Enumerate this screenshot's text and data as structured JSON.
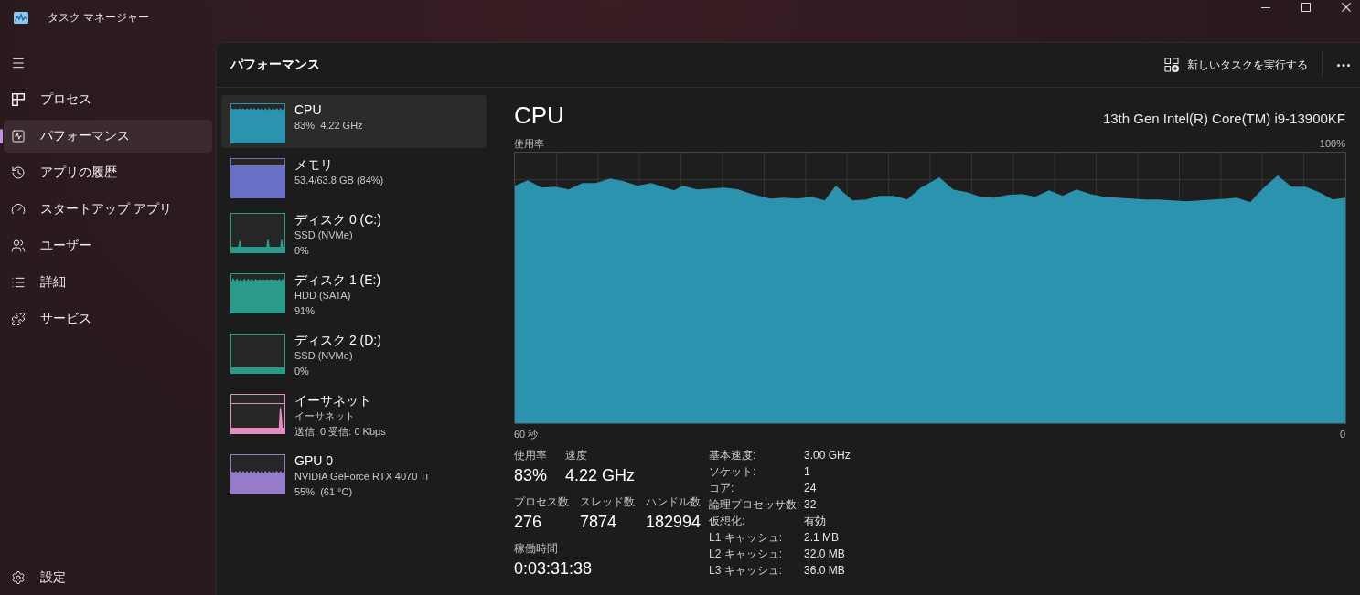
{
  "window": {
    "title": "タスク マネージャー"
  },
  "sidebar": {
    "items": [
      {
        "label": "プロセス",
        "selected": false
      },
      {
        "label": "パフォーマンス",
        "selected": true
      },
      {
        "label": "アプリの履歴",
        "selected": false
      },
      {
        "label": "スタートアップ アプリ",
        "selected": false
      },
      {
        "label": "ユーザー",
        "selected": false
      },
      {
        "label": "詳細",
        "selected": false
      },
      {
        "label": "サービス",
        "selected": false
      }
    ],
    "settings": {
      "label": "設定",
      "selected": false
    }
  },
  "header": {
    "title": "パフォーマンス",
    "run_task_button": "新しいタスクを実行する"
  },
  "devices": [
    {
      "name": "CPU",
      "details": [
        "83%  4.22 GHz"
      ],
      "color": "#2b93ad",
      "selected": true
    },
    {
      "name": "メモリ",
      "details": [
        "53.4/63.8 GB (84%)"
      ],
      "color": "#6870c6",
      "selected": false
    },
    {
      "name": "ディスク 0 (C:)",
      "details": [
        "SSD (NVMe)",
        "0%"
      ],
      "color": "#2a9b8a",
      "selected": false
    },
    {
      "name": "ディスク 1 (E:)",
      "details": [
        "HDD (SATA)",
        "91%"
      ],
      "color": "#2a9b8a",
      "selected": false
    },
    {
      "name": "ディスク 2 (D:)",
      "details": [
        "SSD (NVMe)",
        "0%"
      ],
      "color": "#2a9b8a",
      "selected": false
    },
    {
      "name": "イーサネット",
      "details": [
        "イーサネット",
        "送信: 0 受信: 0 Kbps"
      ],
      "color": "#e38cc1",
      "selected": false
    },
    {
      "name": "GPU 0",
      "details": [
        "NVIDIA GeForce RTX 4070 Ti",
        "55%  (61 °C)"
      ],
      "color": "#967bc8",
      "selected": false
    }
  ],
  "detail": {
    "title": "CPU",
    "model": "13th Gen Intel(R) Core(TM) i9-13900KF",
    "chart": {
      "label": "使用率",
      "max_label": "100%",
      "start_label": "60 秒",
      "end_label": "0"
    },
    "stat_rows": [
      [
        {
          "label": "使用率",
          "value": "83%"
        },
        {
          "label": "速度",
          "value": "4.22 GHz"
        }
      ],
      [
        {
          "label": "プロセス数",
          "value": "276"
        },
        {
          "label": "スレッド数",
          "value": "7874"
        },
        {
          "label": "ハンドル数",
          "value": "182994"
        }
      ],
      [
        {
          "label": "稼働時間",
          "value": "0:03:31:38"
        }
      ]
    ],
    "specs": [
      {
        "label": "基本速度:",
        "value": "3.00 GHz"
      },
      {
        "label": "ソケット:",
        "value": "1"
      },
      {
        "label": "コア:",
        "value": "24"
      },
      {
        "label": "論理プロセッサ数:",
        "value": "32"
      },
      {
        "label": "仮想化:",
        "value": "有効"
      },
      {
        "label": "L1 キャッシュ:",
        "value": "2.1 MB"
      },
      {
        "label": "L2 キャッシュ:",
        "value": "32.0 MB"
      },
      {
        "label": "L3 キャッシュ:",
        "value": "36.0 MB"
      }
    ]
  }
}
